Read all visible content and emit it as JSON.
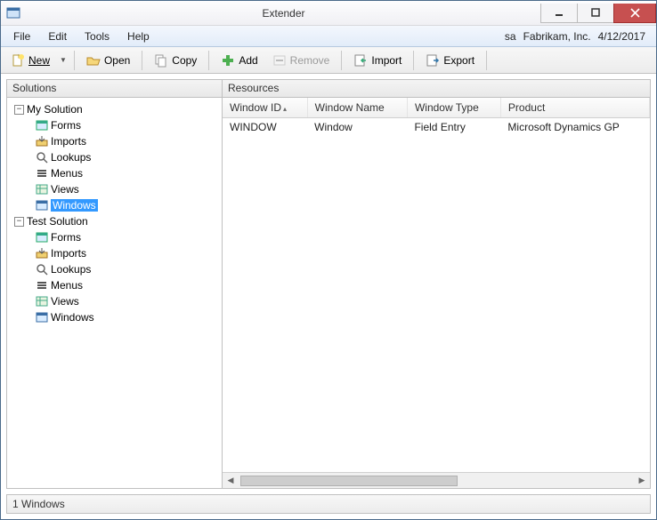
{
  "window": {
    "title": "Extender"
  },
  "menubar": {
    "items": [
      "File",
      "Edit",
      "Tools",
      "Help"
    ],
    "user": "sa",
    "company": "Fabrikam, Inc.",
    "date": "4/12/2017"
  },
  "toolbar": {
    "new": "New",
    "open": "Open",
    "copy": "Copy",
    "add": "Add",
    "remove": "Remove",
    "import": "Import",
    "export": "Export"
  },
  "panes": {
    "solutions_header": "Solutions",
    "resources_header": "Resources"
  },
  "tree": {
    "solutions": [
      {
        "name": "My Solution",
        "expanded": true,
        "children": [
          {
            "name": "Forms",
            "icon": "form"
          },
          {
            "name": "Imports",
            "icon": "import"
          },
          {
            "name": "Lookups",
            "icon": "lookup"
          },
          {
            "name": "Menus",
            "icon": "menu"
          },
          {
            "name": "Views",
            "icon": "view"
          },
          {
            "name": "Windows",
            "icon": "window",
            "selected": true
          }
        ]
      },
      {
        "name": "Test Solution",
        "expanded": true,
        "children": [
          {
            "name": "Forms",
            "icon": "form"
          },
          {
            "name": "Imports",
            "icon": "import"
          },
          {
            "name": "Lookups",
            "icon": "lookup"
          },
          {
            "name": "Menus",
            "icon": "menu"
          },
          {
            "name": "Views",
            "icon": "view"
          },
          {
            "name": "Windows",
            "icon": "window"
          }
        ]
      }
    ]
  },
  "grid": {
    "columns": [
      "Window ID",
      "Window Name",
      "Window Type",
      "Product"
    ],
    "sort_column": 0,
    "rows": [
      {
        "window_id": "WINDOW",
        "window_name": "Window",
        "window_type": "Field Entry",
        "product": "Microsoft Dynamics GP"
      }
    ]
  },
  "statusbar": {
    "text": "1 Windows"
  }
}
